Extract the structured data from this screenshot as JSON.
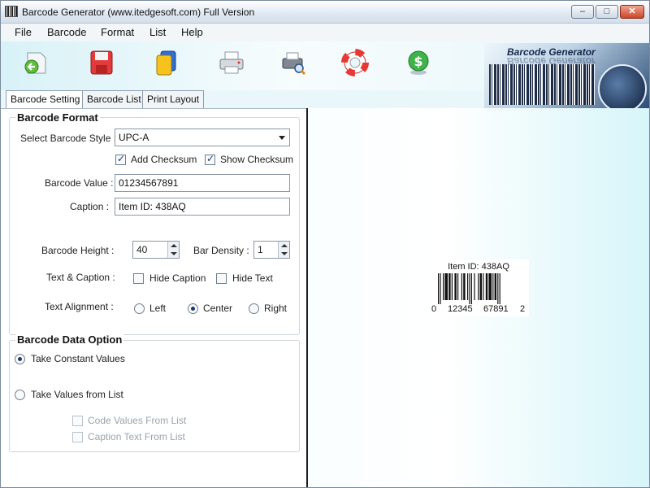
{
  "window": {
    "title": "Barcode Generator (www.itedgesoft.com) Full Version",
    "min": "–",
    "max": "□",
    "close": "✕"
  },
  "menu": [
    "File",
    "Barcode",
    "Format",
    "List",
    "Help"
  ],
  "toolbar": [
    "back-icon",
    "save-icon",
    "copy-icon",
    "print-icon",
    "print-preview-icon",
    "help-lifebuoy-icon",
    "buy-icon"
  ],
  "banner": {
    "title": "Barcode Generator"
  },
  "tabs": [
    "Barcode Setting",
    "Barcode List",
    "Print Layout"
  ],
  "barcode_format": {
    "title": "Barcode Format",
    "style_label": "Select Barcode Style :",
    "style_value": "UPC-A",
    "add_checksum": "Add Checksum",
    "show_checksum": "Show Checksum",
    "value_label": "Barcode Value :",
    "value": "01234567891",
    "caption_label": "Caption :",
    "caption": "Item ID: 438AQ",
    "height_label": "Barcode Height :",
    "height": "40",
    "density_label": "Bar Density :",
    "density": "1",
    "text_caption_label": "Text & Caption :",
    "hide_caption": "Hide Caption",
    "hide_text": "Hide Text",
    "alignment_label": "Text Alignment :",
    "align_left": "Left",
    "align_center": "Center",
    "align_right": "Right"
  },
  "data_option": {
    "title": "Barcode Data Option",
    "constant": "Take Constant Values",
    "from_list": "Take Values from List",
    "code_values": "Code Values From List",
    "caption_text": "Caption Text From List"
  },
  "preview": {
    "caption": "Item ID: 438AQ",
    "digits": [
      "0",
      "12345",
      "67891",
      "2"
    ]
  },
  "colors": {
    "accent": "#1f3a66",
    "panel_bg": "#eaf7fa"
  }
}
